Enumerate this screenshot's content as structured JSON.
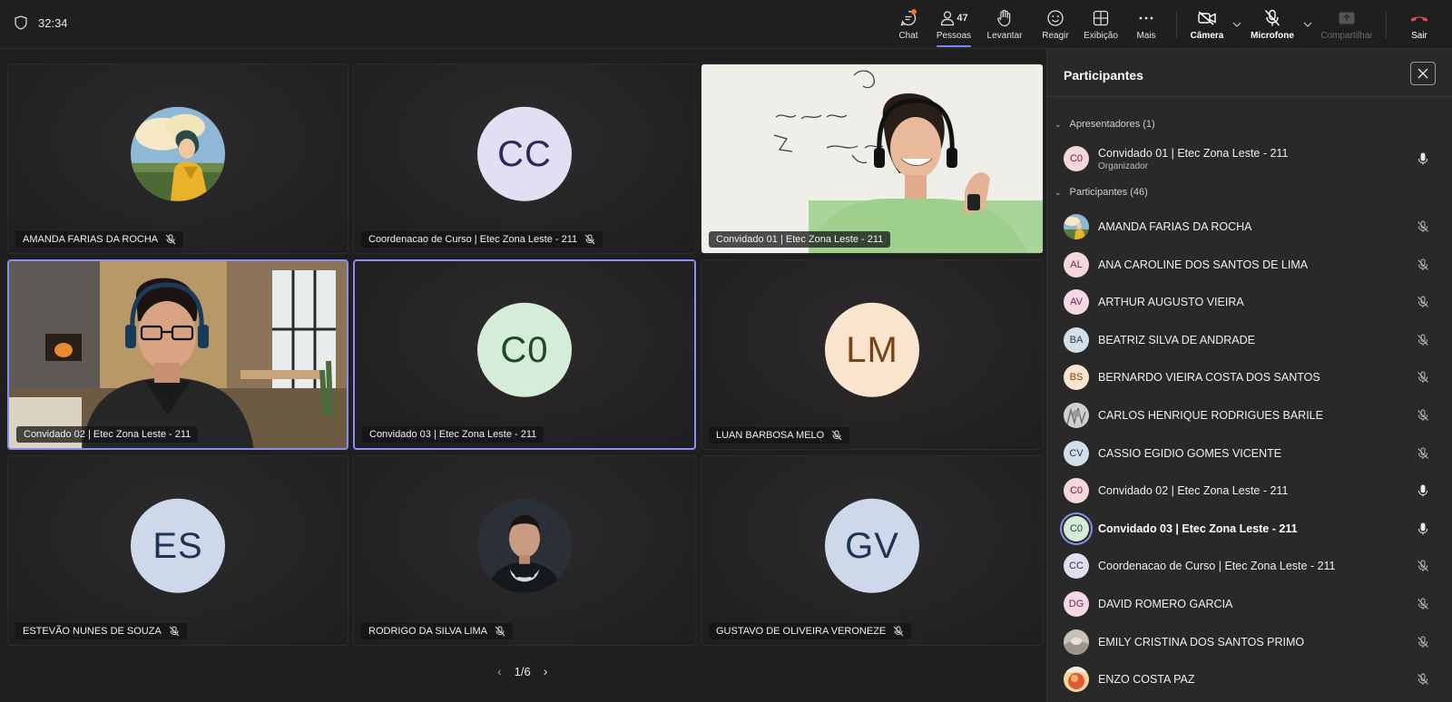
{
  "topbar": {
    "timer": "32:34",
    "buttons": {
      "chat": "Chat",
      "people": "Pessoas",
      "people_count": "47",
      "raise": "Levantar",
      "react": "Reagir",
      "view": "Exibição",
      "more": "Mais",
      "camera": "Câmera",
      "mic": "Microfone",
      "share": "Compartilhar",
      "leave": "Sair"
    }
  },
  "grid": {
    "tiles": [
      {
        "name": "AMANDA FARIAS DA ROCHA",
        "type": "photo-avatar",
        "muted": true
      },
      {
        "name": "Coordenacao de Curso | Etec Zona Leste - 211",
        "initials": "CC",
        "bg": "#e2dff5",
        "fg": "#2b2a5c",
        "muted": true
      },
      {
        "name": "Convidado 01 | Etec Zona Leste - 211",
        "type": "video",
        "muted": false
      },
      {
        "name": "Convidado 02 | Etec Zona Leste - 211",
        "type": "video",
        "muted": false,
        "speaking": true
      },
      {
        "name": "Convidado 03 | Etec Zona Leste - 211",
        "initials": "C0",
        "bg": "#d5ecd9",
        "fg": "#1c4a29",
        "muted": false,
        "speaking": true
      },
      {
        "name": "LUAN BARBOSA MELO",
        "initials": "LM",
        "bg": "#fbe5cf",
        "fg": "#7a4313",
        "muted": true
      },
      {
        "name": "ESTEVÃO NUNES DE SOUZA",
        "initials": "ES",
        "bg": "#cdd9ea",
        "fg": "#1d3458",
        "muted": true
      },
      {
        "name": "RODRIGO DA SILVA LIMA",
        "type": "photo-avatar",
        "muted": true
      },
      {
        "name": "GUSTAVO DE OLIVEIRA VERONEZE",
        "initials": "GV",
        "bg": "#cdd9ea",
        "fg": "#1d3458",
        "muted": true
      }
    ],
    "pager": "1/6"
  },
  "panel": {
    "title": "Participantes",
    "presenters_header": "Apresentadores (1)",
    "participants_header": "Participantes (46)",
    "presenter": {
      "initials": "C0",
      "name": "Convidado 01 | Etec Zona Leste - 211",
      "role": "Organizador",
      "bg": "#f5d7dc",
      "fg": "#6a1f2e"
    },
    "people": [
      {
        "initials": "",
        "name": "AMANDA FARIAS DA ROCHA",
        "photo": "amanda",
        "muted": true
      },
      {
        "initials": "AL",
        "name": "ANA CAROLINE DOS SANTOS DE LIMA",
        "bg": "#f5d7dc",
        "fg": "#7a2436",
        "muted": true
      },
      {
        "initials": "AV",
        "name": "ARTHUR AUGUSTO VIEIRA",
        "bg": "#f5d7e6",
        "fg": "#7a2450",
        "muted": true
      },
      {
        "initials": "BA",
        "name": "BEATRIZ SILVA DE ANDRADE",
        "bg": "#d3dfe8",
        "fg": "#1e3a52",
        "muted": true
      },
      {
        "initials": "BS",
        "name": "BERNARDO VIEIRA COSTA DOS SANTOS",
        "bg": "#fbe5cf",
        "fg": "#7a4313",
        "muted": true
      },
      {
        "initials": "",
        "name": "CARLOS HENRIQUE RODRIGUES BARILE",
        "photo": "carlos",
        "muted": true
      },
      {
        "initials": "CV",
        "name": "CASSIO EGIDIO GOMES VICENTE",
        "bg": "#d3dfe8",
        "fg": "#1e3a52",
        "muted": true
      },
      {
        "initials": "C0",
        "name": "Convidado 02 | Etec Zona Leste - 211",
        "bg": "#f5d7dc",
        "fg": "#6a1f2e",
        "muted": false
      },
      {
        "initials": "C0",
        "name": "Convidado 03 | Etec Zona Leste - 211",
        "bg": "#d5ecd9",
        "fg": "#1c4a29",
        "muted": false,
        "bold": true
      },
      {
        "initials": "CC",
        "name": "Coordenacao de Curso | Etec Zona Leste - 211",
        "bg": "#e2dff5",
        "fg": "#2b2a5c",
        "muted": true
      },
      {
        "initials": "DG",
        "name": "DAVID ROMERO GARCIA",
        "bg": "#f5d7e6",
        "fg": "#7a2450",
        "muted": true
      },
      {
        "initials": "",
        "name": "EMILY CRISTINA DOS SANTOS PRIMO",
        "photo": "emily",
        "muted": true
      },
      {
        "initials": "",
        "name": "ENZO COSTA PAZ",
        "photo": "enzo",
        "muted": true
      }
    ]
  }
}
